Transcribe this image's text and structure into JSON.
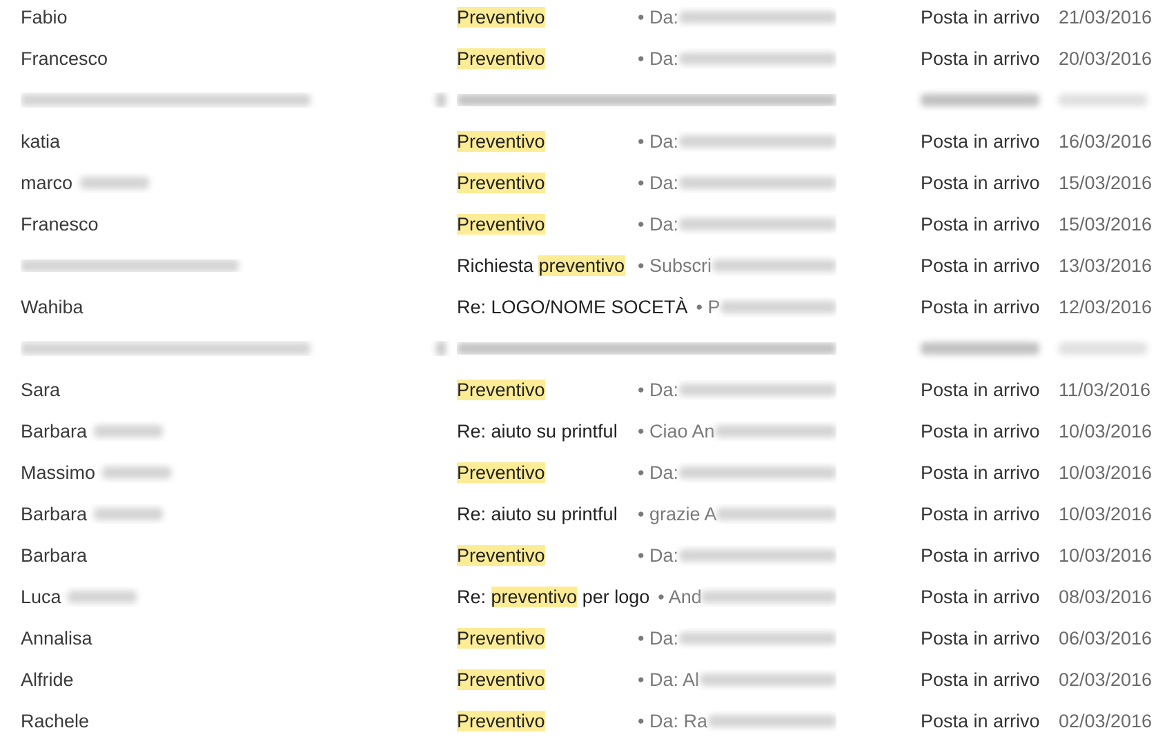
{
  "rows": [
    {
      "kind": "message",
      "sender": "Fabio",
      "sender_hidden_part": false,
      "subject": [
        {
          "text": "Preventivo",
          "highlight": true
        }
      ],
      "preview": "• Da:",
      "folder": "Posta in arrivo",
      "date": "21/03/2016"
    },
    {
      "kind": "message",
      "sender": "Francesco",
      "sender_hidden_part": false,
      "subject": [
        {
          "text": "Preventivo",
          "highlight": true
        }
      ],
      "preview": "• Da:",
      "folder": "Posta in arrivo",
      "date": "20/03/2016"
    },
    {
      "kind": "redacted"
    },
    {
      "kind": "message",
      "sender": "katia",
      "sender_hidden_part": false,
      "subject": [
        {
          "text": "Preventivo",
          "highlight": true
        }
      ],
      "preview": "• Da:",
      "folder": "Posta in arrivo",
      "date": "16/03/2016"
    },
    {
      "kind": "message",
      "sender": "marco",
      "sender_hidden_part": true,
      "subject": [
        {
          "text": "Preventivo",
          "highlight": true
        }
      ],
      "preview": "• Da:",
      "folder": "Posta in arrivo",
      "date": "15/03/2016"
    },
    {
      "kind": "message",
      "sender": "Franesco",
      "sender_hidden_part": false,
      "subject": [
        {
          "text": "Preventivo",
          "highlight": true
        }
      ],
      "preview": "• Da:",
      "folder": "Posta in arrivo",
      "date": "15/03/2016"
    },
    {
      "kind": "message",
      "sender_hidden_whole": true,
      "subject": [
        {
          "text": "Richiesta ",
          "highlight": false
        },
        {
          "text": "preventivo",
          "highlight": true
        }
      ],
      "preview": "• Subscri",
      "folder": "Posta in arrivo",
      "date": "13/03/2016"
    },
    {
      "kind": "message",
      "sender": "Wahiba",
      "sender_hidden_part": false,
      "subject": [
        {
          "text": "Re: LOGO/NOME SOCETÀ",
          "highlight": false
        }
      ],
      "preview": "• P",
      "folder": "Posta in arrivo",
      "date": "12/03/2016"
    },
    {
      "kind": "redacted"
    },
    {
      "kind": "message",
      "sender": "Sara",
      "sender_hidden_part": false,
      "subject": [
        {
          "text": "Preventivo",
          "highlight": true
        }
      ],
      "preview": "• Da:",
      "folder": "Posta in arrivo",
      "date": "11/03/2016"
    },
    {
      "kind": "message",
      "sender": "Barbara",
      "sender_hidden_part": true,
      "subject": [
        {
          "text": "Re: aiuto su printful",
          "highlight": false
        }
      ],
      "preview": "• Ciao An",
      "folder": "Posta in arrivo",
      "date": "10/03/2016"
    },
    {
      "kind": "message",
      "sender": "Massimo",
      "sender_hidden_part": true,
      "subject": [
        {
          "text": "Preventivo",
          "highlight": true
        }
      ],
      "preview": "• Da:",
      "folder": "Posta in arrivo",
      "date": "10/03/2016"
    },
    {
      "kind": "message",
      "sender": "Barbara",
      "sender_hidden_part": true,
      "subject": [
        {
          "text": "Re: aiuto su printful",
          "highlight": false
        }
      ],
      "preview": "• grazie A",
      "folder": "Posta in arrivo",
      "date": "10/03/2016"
    },
    {
      "kind": "message",
      "sender": "Barbara",
      "sender_hidden_part": false,
      "subject": [
        {
          "text": "Preventivo",
          "highlight": true
        }
      ],
      "preview": "• Da:",
      "folder": "Posta in arrivo",
      "date": "10/03/2016"
    },
    {
      "kind": "message",
      "sender": "Luca",
      "sender_hidden_part": true,
      "subject": [
        {
          "text": "Re: ",
          "highlight": false
        },
        {
          "text": "preventivo",
          "highlight": true
        },
        {
          "text": " per logo",
          "highlight": false
        }
      ],
      "preview": "• And",
      "folder": "Posta in arrivo",
      "date": "08/03/2016"
    },
    {
      "kind": "message",
      "sender": "Annalisa",
      "sender_hidden_part": false,
      "subject": [
        {
          "text": "Preventivo",
          "highlight": true
        }
      ],
      "preview": "• Da:",
      "folder": "Posta in arrivo",
      "date": "06/03/2016"
    },
    {
      "kind": "message",
      "sender": "Alfride",
      "sender_hidden_part": false,
      "subject": [
        {
          "text": "Preventivo",
          "highlight": true
        }
      ],
      "preview": "• Da: Al",
      "folder": "Posta in arrivo",
      "date": "02/03/2016"
    },
    {
      "kind": "message",
      "sender": "Rachele",
      "sender_hidden_part": false,
      "subject": [
        {
          "text": "Preventivo",
          "highlight": true
        }
      ],
      "preview": "• Da: Ra",
      "folder": "Posta in arrivo",
      "date": "02/03/2016"
    }
  ]
}
